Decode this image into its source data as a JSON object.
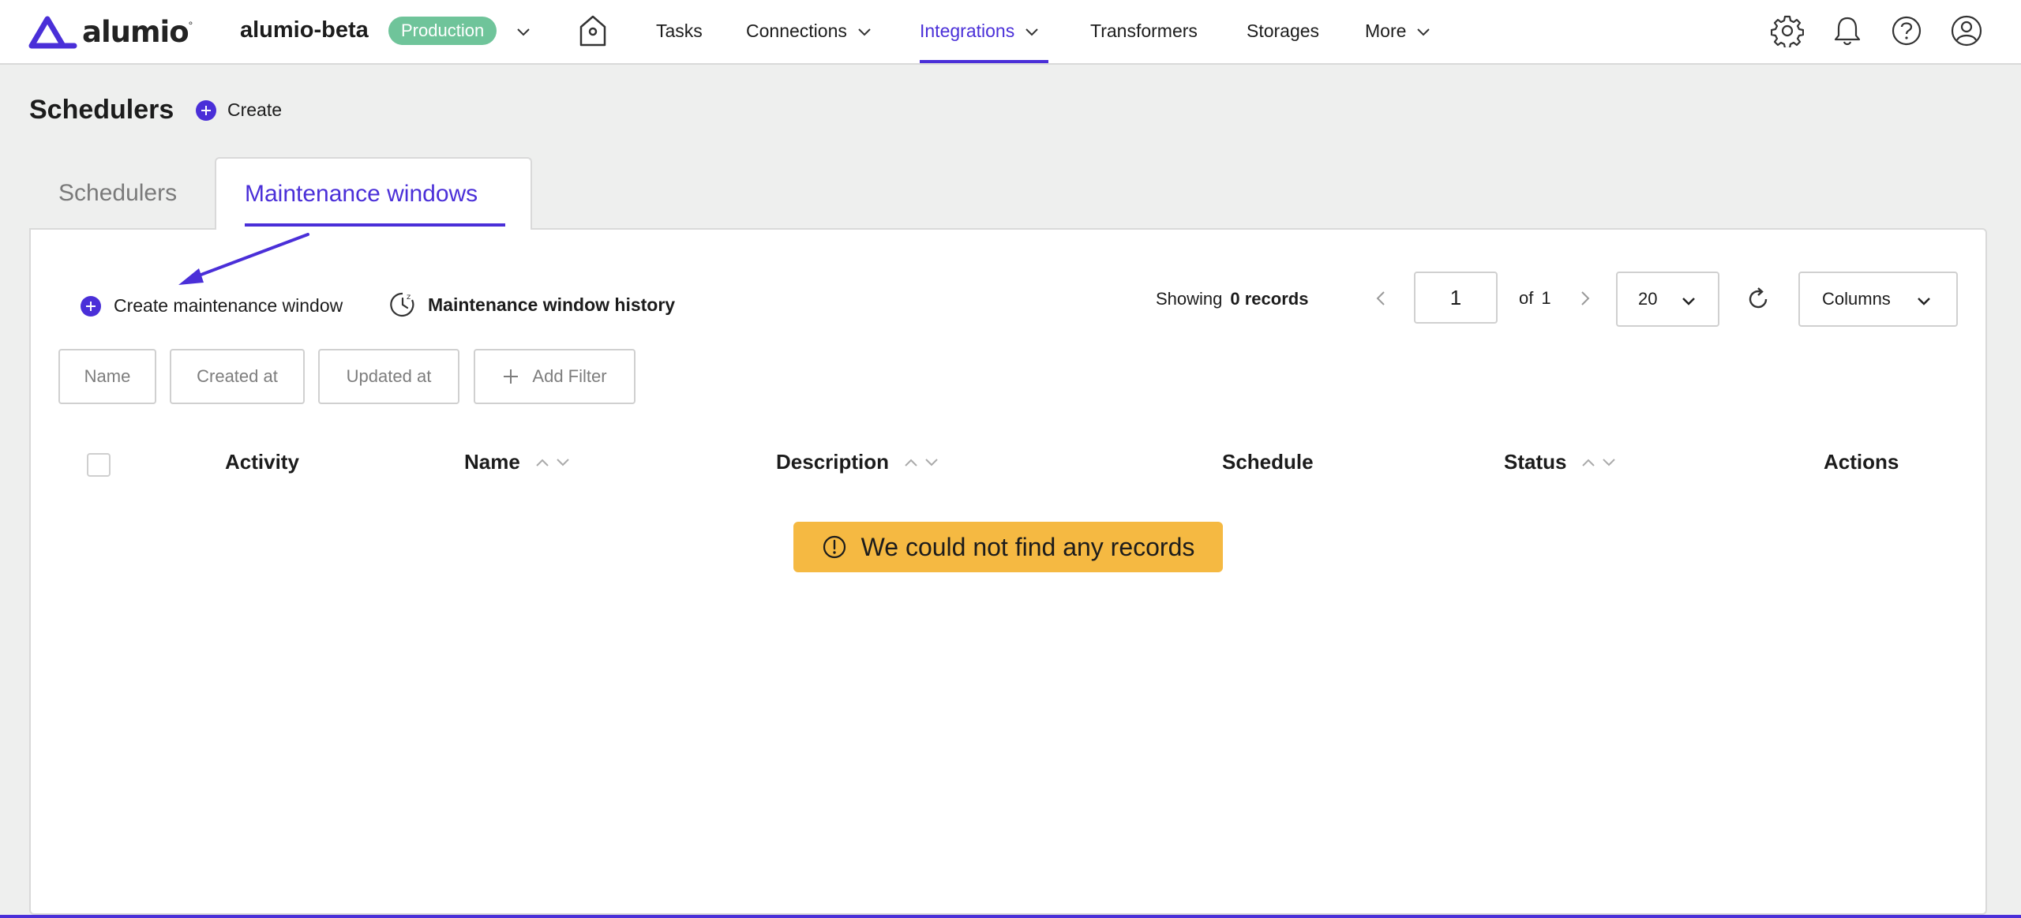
{
  "brand": {
    "logo_text": "alumio"
  },
  "topnav": {
    "workspace": "alumio-beta",
    "environment": "Production",
    "items": [
      {
        "label": "Tasks"
      },
      {
        "label": "Connections"
      },
      {
        "label": "Integrations",
        "active": true
      },
      {
        "label": "Transformers"
      },
      {
        "label": "Storages"
      },
      {
        "label": "More"
      }
    ],
    "right_icons": [
      "gear-icon",
      "bell-icon",
      "help-icon",
      "user-icon"
    ]
  },
  "page": {
    "title": "Schedulers",
    "create_label": "Create"
  },
  "tabs": [
    {
      "label": "Schedulers",
      "active": false
    },
    {
      "label": "Maintenance windows",
      "active": true
    }
  ],
  "toolbar": {
    "create_label": "Create maintenance window",
    "history_label": "Maintenance window history",
    "showing_label": "Showing",
    "records_label": "0 records",
    "page_value": "1",
    "of_label": "of",
    "total_pages": "1",
    "per_page": "20",
    "columns_label": "Columns"
  },
  "filters": [
    {
      "label": "Name"
    },
    {
      "label": "Created at"
    },
    {
      "label": "Updated at"
    },
    {
      "label": "Add Filter"
    }
  ],
  "table": {
    "columns": [
      {
        "label": "Activity"
      },
      {
        "label": "Name"
      },
      {
        "label": "Description"
      },
      {
        "label": "Schedule"
      },
      {
        "label": "Status"
      },
      {
        "label": "Actions"
      }
    ],
    "empty_message": "We could not find any records"
  },
  "colors": {
    "accent": "#4a2fd8",
    "env_badge": "#6fc49a",
    "warning": "#f5b942"
  }
}
